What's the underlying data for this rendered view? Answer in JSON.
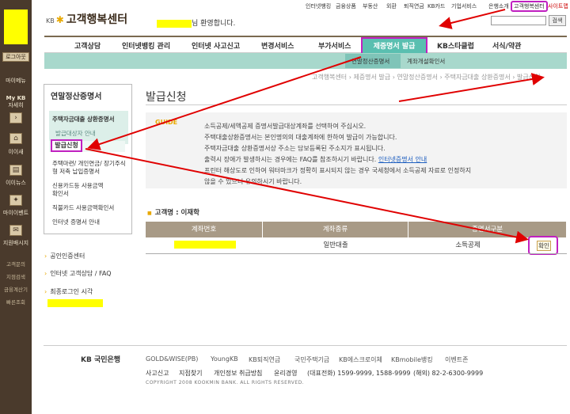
{
  "top_links": [
    "인터넷뱅킹",
    "금융상품",
    "부동산",
    "외환",
    "퇴직연금",
    "KB카드",
    "기업서비스",
    "은행소개",
    "고객행복센터",
    "사이트맵"
  ],
  "logo": {
    "kb": "KB",
    "title": "고객행복센터"
  },
  "welcome": "님 환영합니다.",
  "search_button": "검색",
  "gnb": [
    "고객상담",
    "인터넷뱅킹 관리",
    "인터넷 사고신고",
    "변경서비스",
    "부가서비스",
    "제증명서 발급",
    "KB스타클럽",
    "서식/약관"
  ],
  "lnb": [
    "연말정산증명서",
    "계좌개설확인서"
  ],
  "breadcrumb": "고객행복센터 › 제증명서 발급 › 연말정산증명서 › 주택자금대출 상환증명서 › 발급신청",
  "rail": {
    "logout": "로그아웃",
    "my_menu": "마이메뉴",
    "my_kb": "My KB",
    "my_kb_sub": "자세히",
    "items": [
      "이이새",
      "이이뉴스",
      "마이이벤트",
      "지원배시지"
    ],
    "small": [
      "고객문의",
      "지점검색",
      "금융계산기",
      "빠른조회"
    ]
  },
  "side": {
    "title": "연말정산증명서",
    "section": "주택자금대출 상환증명서",
    "sub1": "발급대상자 안내",
    "sub2": "발급신청",
    "items": [
      "주택마련/ 개인연금/ 장기주식형 저축 납입증명서",
      "신용카드등 사용금액확인서",
      "직불카드 사용금액확인서",
      "인터넷 증명서 안내"
    ],
    "links": [
      "공인인증센터",
      "인터넷 고객상담 / FAQ",
      "최종로그인 시각"
    ]
  },
  "main": {
    "page_title": "발급신청",
    "guide_label": "GUIDE",
    "guide_lines": [
      "소득공제/세액공제 증명서발급대상계좌를 선택하여 주십시오.",
      "주택대출상환증명서는 본인명의의 대출계좌에 한하여 발급이 가능합니다.",
      "주택자금대출 상환증명서상 주소는 담보등록된 주소지가 표시됩니다.",
      "출력시 장애가 발생하시는 경우에는 FAQ를 참조하시기 바랍니다.",
      "프린터 해상도로 인하여 워터마크가 정확히 표시되지 않는 경우 국세청에서 소득공제 자료로 인정하지",
      "않을 수 있으니 유의하시기 바랍니다."
    ],
    "guide_link": "인터넷증명서 안내",
    "customer": "고객명 : 이재학",
    "table_headers": [
      "계좌번호",
      "계좌종류",
      "증명서구분"
    ],
    "row": {
      "type": "일반대출",
      "kind": "소득공제",
      "action": "확인"
    }
  },
  "footer": {
    "logo": "KB 국민은행",
    "links": [
      "GOLD&WISE(PB)",
      "YoungKB",
      "KB퇴직연금",
      "국민주택기금",
      "KB에스크로이체",
      "KBmobile뱅킹",
      "이벤트존"
    ],
    "links2": [
      "사고신고",
      "지점찾기",
      "개인정보 취급방침",
      "윤리경영",
      "(대표전화) 1599-9999, 1588-9999",
      "(해외) 82-2-6300-9999"
    ],
    "copyright": "COPYRIGHT 2008 KOOKMIN BANK. ALL RIGHTS RESERVED."
  }
}
